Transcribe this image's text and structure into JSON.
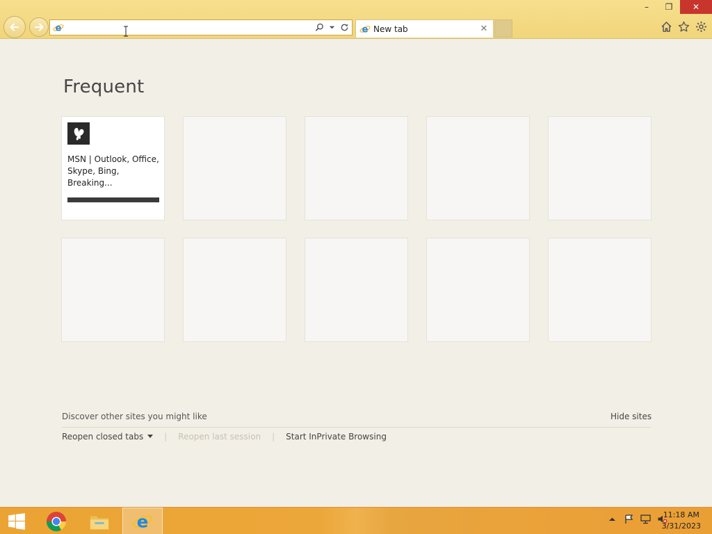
{
  "window": {
    "controls": {
      "minimize": "–",
      "restore": "❐",
      "close": "✕"
    }
  },
  "nav": {
    "back_icon": "back-arrow-icon",
    "forward_icon": "forward-arrow-icon"
  },
  "address_bar": {
    "value": "",
    "placeholder": "",
    "icons": [
      "ie-icon",
      "search-icon",
      "dropdown-icon",
      "refresh-icon"
    ]
  },
  "tabs": [
    {
      "label": "New tab",
      "active": true,
      "close": "✕"
    }
  ],
  "toolbar": {
    "icons": [
      "home-icon",
      "favorites-icon",
      "settings-icon"
    ]
  },
  "page": {
    "heading": "Frequent",
    "tiles": [
      {
        "title": "MSN | Outlook, Office, Skype, Bing, Breaking...",
        "icon": "msn-butterfly-icon"
      },
      {
        "title": ""
      },
      {
        "title": ""
      },
      {
        "title": ""
      },
      {
        "title": ""
      },
      {
        "title": ""
      },
      {
        "title": ""
      },
      {
        "title": ""
      },
      {
        "title": ""
      },
      {
        "title": ""
      }
    ],
    "discover": "Discover other sites you might like",
    "hide_sites": "Hide sites",
    "reopen_closed": "Reopen closed tabs",
    "reopen_last": "Reopen last session",
    "inprivate": "Start InPrivate Browsing"
  },
  "taskbar": {
    "apps": [
      "start-icon",
      "chrome-icon",
      "file-explorer-icon",
      "internet-explorer-icon"
    ],
    "tray": [
      "show-hidden-icons-icon",
      "action-center-flag-icon",
      "network-icon",
      "volume-muted-icon"
    ],
    "time": "11:18 AM",
    "date": "3/31/2023"
  },
  "colors": {
    "chrome_bg": "#f6df8e",
    "page_bg": "#f2efe6",
    "close_btn": "#c7352c",
    "taskbar": "#eba433"
  }
}
